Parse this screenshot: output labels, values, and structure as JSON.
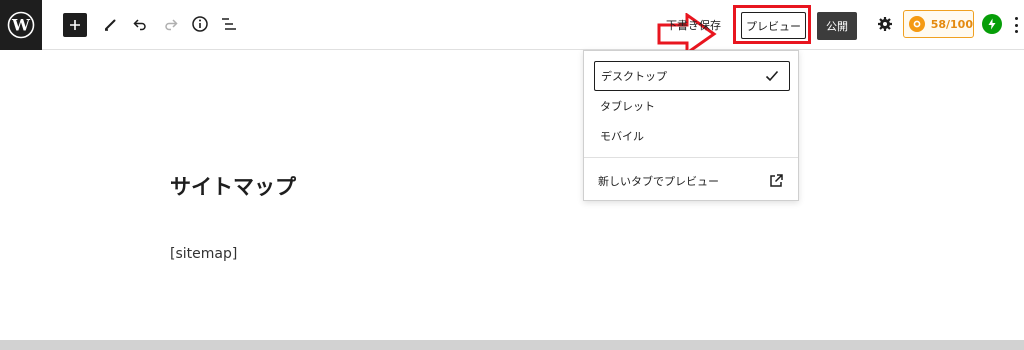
{
  "toolbar": {
    "draft_save_label": "下書き保存",
    "preview_label": "プレビュー",
    "publish_label": "公開",
    "score_label": "58/100"
  },
  "preview_menu": {
    "items": [
      {
        "label": "デスクトップ",
        "selected": true
      },
      {
        "label": "タブレット",
        "selected": false
      },
      {
        "label": "モバイル",
        "selected": false
      }
    ],
    "new_tab_label": "新しいタブでプレビュー"
  },
  "editor": {
    "title": "サイトマップ",
    "shortcode": "[sitemap]"
  },
  "colors": {
    "highlight": "#e8151f",
    "score": "#e48a10",
    "jetpack": "#069e08"
  }
}
